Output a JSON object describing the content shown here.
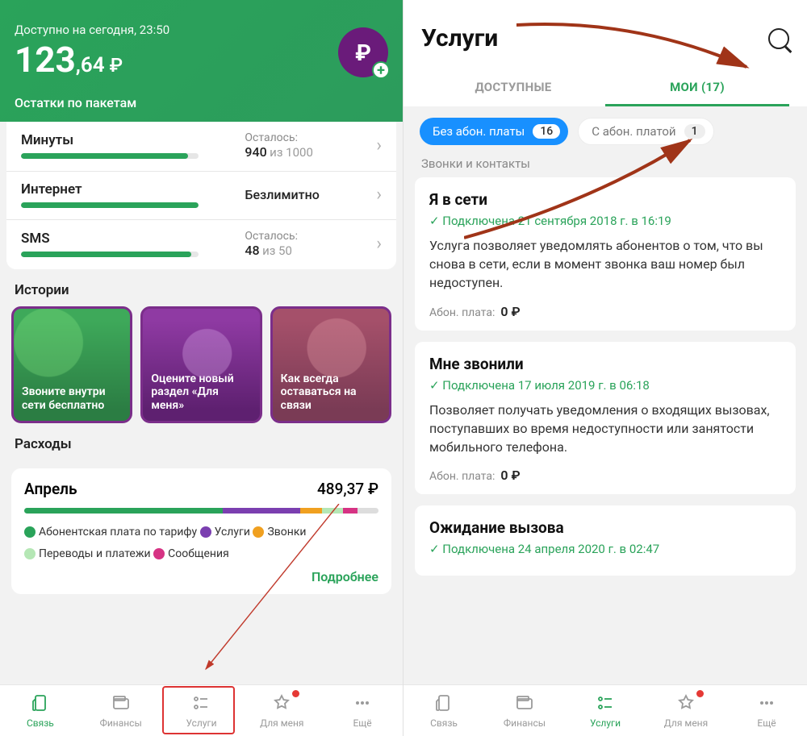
{
  "left": {
    "availLabel": "Доступно на сегодня, 23:50",
    "balanceWhole": "123",
    "balanceFrac": ",64",
    "balanceCur": "₽",
    "packagesTitle": "Остатки по пакетам",
    "packages": [
      {
        "name": "Минуты",
        "label": "Осталось:",
        "value": "940",
        "of": "из 1000",
        "fill": 94
      },
      {
        "name": "Интернет",
        "label": "",
        "value": "Безлимитно",
        "of": "",
        "fill": 100
      },
      {
        "name": "SMS",
        "label": "Осталось:",
        "value": "48",
        "of": "из 50",
        "fill": 96
      }
    ],
    "storiesTitle": "Истории",
    "stories": [
      "Звоните внутри сети бесплатно",
      "Оцените новый раздел «Для меня»",
      "Как всегда оставаться на связи"
    ],
    "expensesTitle": "Расходы",
    "expense": {
      "month": "Апрель",
      "total": "489,37 ₽",
      "bars": [
        {
          "color": "#2aa35a",
          "w": 56
        },
        {
          "color": "#7b3fb0",
          "w": 22
        },
        {
          "color": "#f0a020",
          "w": 6
        },
        {
          "color": "#b5e7b5",
          "w": 6
        },
        {
          "color": "#d63384",
          "w": 4
        },
        {
          "color": "#ddd",
          "w": 6
        }
      ],
      "legend": [
        {
          "color": "#2aa35a",
          "label": "Абонентская плата по тарифу"
        },
        {
          "color": "#7b3fb0",
          "label": "Услуги"
        },
        {
          "color": "#f0a020",
          "label": "Звонки"
        },
        {
          "color": "#b5e7b5",
          "label": "Переводы и платежи"
        },
        {
          "color": "#d63384",
          "label": "Сообщения"
        }
      ],
      "more": "Подробнее"
    }
  },
  "right": {
    "title": "Услуги",
    "tabs": {
      "available": "ДОСТУПНЫЕ",
      "mine": "МОИ (17)"
    },
    "chips": [
      {
        "label": "Без абон. платы",
        "badge": "16",
        "active": true
      },
      {
        "label": "С абон. платой",
        "badge": "1",
        "active": false
      }
    ],
    "groupTitle": "Звонки и контакты",
    "services": [
      {
        "name": "Я в сети",
        "status": "Подключена 21 сентября 2018 г. в 16:19",
        "desc": "Услуга позволяет уведомлять абонентов о том, что вы снова в сети, если в момент звонка ваш номер был недоступен.",
        "feeLabel": "Абон. плата:",
        "fee": "0 ₽"
      },
      {
        "name": "Мне звонили",
        "status": "Подключена 17 июля 2019 г. в 06:18",
        "desc": "Позволяет получать уведомления о входящих вызовах, поступавших во время недоступности или занятости мобильного телефона.",
        "feeLabel": "Абон. плата:",
        "fee": "0 ₽"
      },
      {
        "name": "Ожидание вызова",
        "status": "Подключена 24 апреля 2020 г. в 02:47",
        "desc": "",
        "feeLabel": "",
        "fee": ""
      }
    ]
  },
  "nav": [
    {
      "label": "Связь",
      "icon": "sim"
    },
    {
      "label": "Финансы",
      "icon": "wallet"
    },
    {
      "label": "Услуги",
      "icon": "services"
    },
    {
      "label": "Для меня",
      "icon": "star",
      "dot": true
    },
    {
      "label": "Ещё",
      "icon": "more"
    }
  ]
}
